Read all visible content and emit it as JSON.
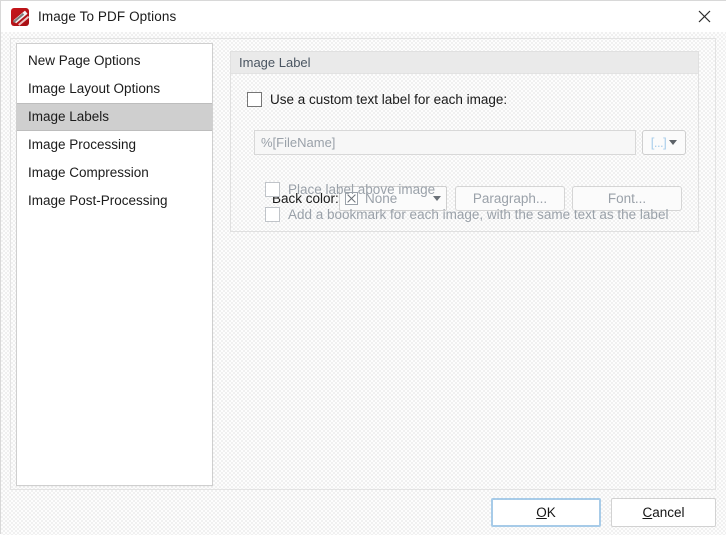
{
  "window": {
    "title": "Image To PDF Options",
    "app_icon": "pdf-image-icon",
    "close_icon": "close-icon"
  },
  "sidebar": {
    "items": [
      {
        "label": "New Page Options",
        "selected": false
      },
      {
        "label": "Image Layout Options",
        "selected": false
      },
      {
        "label": "Image Labels",
        "selected": true
      },
      {
        "label": "Image Processing",
        "selected": false
      },
      {
        "label": "Image Compression",
        "selected": false
      },
      {
        "label": "Image Post-Processing",
        "selected": false
      }
    ]
  },
  "main": {
    "group": {
      "title": "Image Label"
    },
    "custom_label_checkbox": {
      "label": "Use a custom text label for each image:",
      "checked": false,
      "enabled": true
    },
    "label_textfield": {
      "value": "%[FileName]",
      "placeholder": "%[FileName]",
      "enabled": false
    },
    "macro_button": {
      "brackets": "[...]",
      "icon": "macro-brackets-icon",
      "dropdown_icon": "chevron-down-icon"
    },
    "back_color": {
      "label": "Back color:",
      "selected": "None",
      "swatch_icon": "no-color-swatch-icon",
      "dropdown_icon": "chevron-down-icon",
      "enabled": false
    },
    "paragraph_button": {
      "label": "Paragraph...",
      "enabled": false
    },
    "font_button": {
      "label": "Font...",
      "enabled": false
    },
    "place_above_checkbox": {
      "label": "Place label above image",
      "checked": false,
      "enabled": false
    },
    "bookmark_checkbox": {
      "label": "Add a bookmark for each image, with the same text as the label",
      "checked": false,
      "enabled": false
    }
  },
  "footer": {
    "ok": {
      "label": "OK",
      "mnemonic": "O",
      "rest": "K",
      "default": true
    },
    "cancel": {
      "label": "Cancel",
      "mnemonic": "C",
      "rest": "ancel"
    }
  },
  "colors": {
    "selection_gray": "#cfcfcf",
    "focus_blue": "#a7cbe8",
    "disabled_text": "#9aa1a9",
    "group_header_text": "#4a5561",
    "icon_red": "#c9161b"
  }
}
